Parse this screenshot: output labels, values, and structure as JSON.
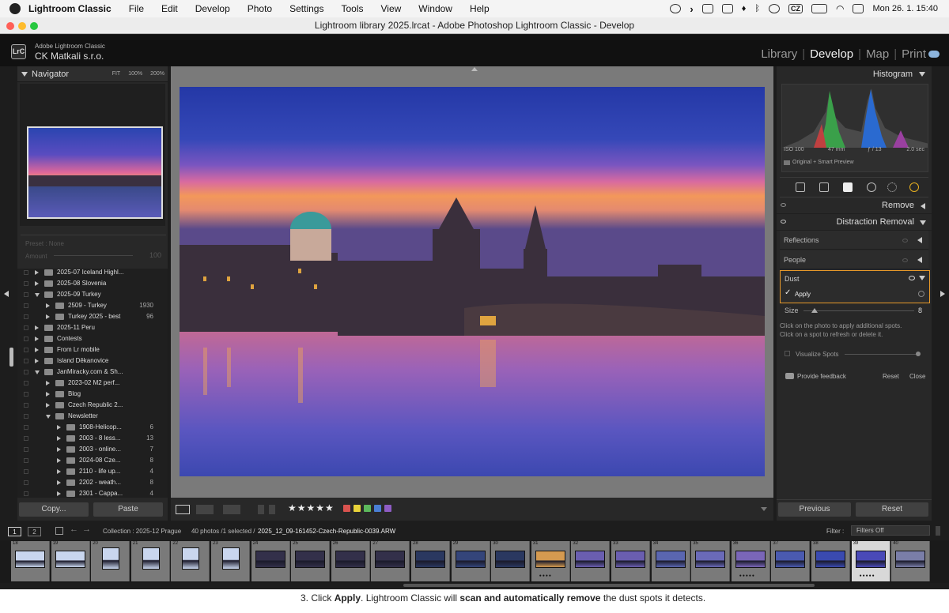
{
  "menubar": {
    "app": "Lightroom Classic",
    "items": [
      "File",
      "Edit",
      "Develop",
      "Photo",
      "Settings",
      "Tools",
      "View",
      "Window",
      "Help"
    ],
    "keyboard": "CZ",
    "clock": "Mon 26. 1.  15:40"
  },
  "window": {
    "title": "Lightroom library 2025.lrcat - Adobe Photoshop Lightroom Classic - Develop"
  },
  "header": {
    "logo": "LrC",
    "identity_small": "Adobe Lightroom Classic",
    "identity_name": "CK Matkali s.r.o.",
    "modules": [
      "Library",
      "Develop",
      "Map",
      "Print"
    ],
    "active_module": "Develop"
  },
  "left": {
    "navigator": {
      "title": "Navigator",
      "zoom_fit": "FIT",
      "zoom_100": "100%",
      "zoom_200": "200%"
    },
    "preset": {
      "label": "Preset : None",
      "amount_label": "Amount",
      "amount_value": "100"
    },
    "collections": [
      {
        "name": "2025-07 Iceland Highl...",
        "count": "",
        "indent": 0,
        "open": false
      },
      {
        "name": "2025-08 Slovenia",
        "count": "",
        "indent": 0,
        "open": false
      },
      {
        "name": "2025-09 Turkey",
        "count": "",
        "indent": 0,
        "open": true
      },
      {
        "name": "2509 - Turkey",
        "count": "1930",
        "indent": 1,
        "open": false
      },
      {
        "name": "Turkey 2025 - best",
        "count": "96",
        "indent": 1,
        "open": false
      },
      {
        "name": "2025-11 Peru",
        "count": "",
        "indent": 0,
        "open": false
      },
      {
        "name": "Contests",
        "count": "",
        "indent": 0,
        "open": false
      },
      {
        "name": "From Lr mobile",
        "count": "",
        "indent": 0,
        "open": false
      },
      {
        "name": "Island Děkanovice",
        "count": "",
        "indent": 0,
        "open": false
      },
      {
        "name": "JanMiracky.com & Sh...",
        "count": "",
        "indent": 0,
        "open": true
      },
      {
        "name": "2023-02 M2 perf...",
        "count": "",
        "indent": 1,
        "open": false
      },
      {
        "name": "Blog",
        "count": "",
        "indent": 1,
        "open": false
      },
      {
        "name": "Czech Republic 2...",
        "count": "",
        "indent": 1,
        "open": false
      },
      {
        "name": "Newsletter",
        "count": "",
        "indent": 1,
        "open": true
      },
      {
        "name": "1908-Helicop...",
        "count": "6",
        "indent": 2,
        "open": false
      },
      {
        "name": "2003 - 8 less...",
        "count": "13",
        "indent": 2,
        "open": false
      },
      {
        "name": "2003 - online...",
        "count": "7",
        "indent": 2,
        "open": false
      },
      {
        "name": "2024-08 Cze...",
        "count": "8",
        "indent": 2,
        "open": false
      },
      {
        "name": "2110 - life up...",
        "count": "4",
        "indent": 2,
        "open": false
      },
      {
        "name": "2202 - weath...",
        "count": "8",
        "indent": 2,
        "open": false
      },
      {
        "name": "2301 - Cappa...",
        "count": "4",
        "indent": 2,
        "open": false
      }
    ],
    "copy_label": "Copy...",
    "paste_label": "Paste"
  },
  "toolbar": {
    "stars": "★★★★★",
    "color_labels": [
      "#d9534f",
      "#e8d23a",
      "#5cb85c",
      "#4a7fd4",
      "#8e5cc4"
    ]
  },
  "right": {
    "histogram": {
      "title": "Histogram",
      "iso": "ISO 100",
      "focal": "47 mm",
      "aperture": "ƒ / 13",
      "shutter": "2.0 sec",
      "preview": "Original + Smart Preview"
    },
    "remove_label": "Remove",
    "distraction_label": "Distraction Removal",
    "reflections_label": "Reflections",
    "people_label": "People",
    "dust_label": "Dust",
    "apply_label": "Apply",
    "size_label": "Size",
    "size_value": "8",
    "size_fraction": 0.1,
    "hint1": "Click on the photo to apply additional spots.",
    "hint2": "Click on a spot to refresh or delete it.",
    "visualize_label": "Visualize Spots",
    "feedback_label": "Provide feedback",
    "reset_small": "Reset",
    "close_label": "Close",
    "previous_label": "Previous",
    "reset_label": "Reset"
  },
  "filmbar": {
    "page1": "1",
    "page2": "2",
    "collection": "Collection : 2025-12 Prague",
    "count": "40 photos /1 selected /",
    "filename": "2025_12_09-161452-Czech-Republic-0039.ARW",
    "filter_label": "Filter :",
    "filter_value": "Filters Off"
  },
  "filmstrip": {
    "numbers": [
      "18",
      "19",
      "20",
      "21",
      "22",
      "23",
      "24",
      "25",
      "26",
      "27",
      "28",
      "29",
      "30",
      "31",
      "32",
      "33",
      "34",
      "35",
      "36",
      "37",
      "38",
      "39",
      "40"
    ],
    "selected": "39"
  },
  "doc": {
    "text_pre": "3.  Click ",
    "bold1": "Apply",
    "text_mid": ". Lightroom Classic will ",
    "bold2": "scan and automatically remove",
    "text_post": " the dust spots it detects."
  }
}
